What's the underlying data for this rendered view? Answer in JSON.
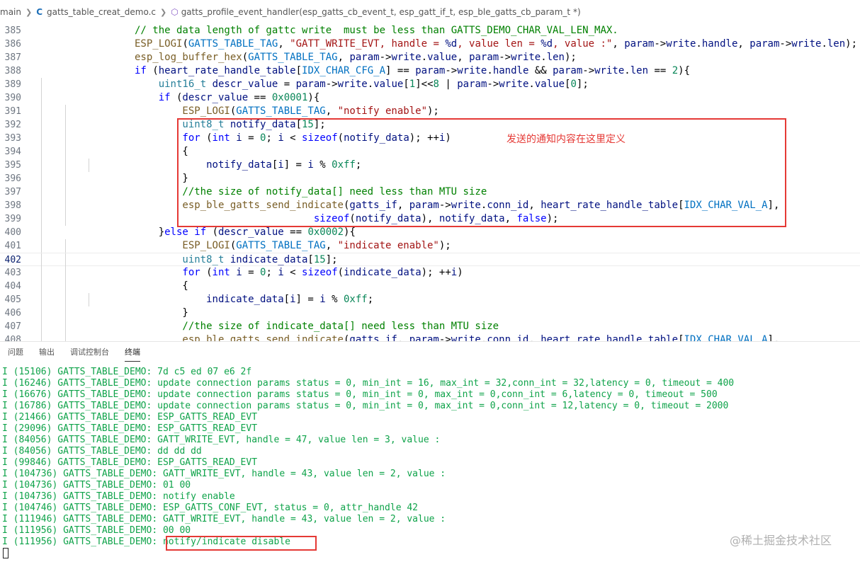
{
  "breadcrumb": {
    "items": [
      "main",
      "gatts_table_creat_demo.c",
      "gatts_profile_event_handler(esp_gatts_cb_event_t, esp_gatt_if_t, esp_ble_gatts_cb_param_t *)"
    ],
    "icons": [
      "c-file-icon",
      "function-cube-icon"
    ]
  },
  "editor": {
    "current_line": 402,
    "lines": [
      {
        "n": 385,
        "indent": 4,
        "tokens": [
          [
            "cm",
            "// the data length of gattc write  must be less than GATTS_DEMO_CHAR_VAL_LEN_MAX."
          ]
        ]
      },
      {
        "n": 386,
        "indent": 4,
        "tokens": [
          [
            "fn",
            "ESP_LOGI"
          ],
          [
            "plain",
            "("
          ],
          [
            "mac",
            "GATTS_TABLE_TAG"
          ],
          [
            "plain",
            ", "
          ],
          [
            "str",
            "\"GATT_WRITE_EVT, handle = "
          ],
          [
            "var",
            "%d"
          ],
          [
            "str",
            ", value len = "
          ],
          [
            "var",
            "%d"
          ],
          [
            "str",
            ", value :\""
          ],
          [
            "plain",
            ", "
          ],
          [
            "var",
            "param"
          ],
          [
            "plain",
            "->"
          ],
          [
            "var",
            "write"
          ],
          [
            "plain",
            "."
          ],
          [
            "var",
            "handle"
          ],
          [
            "plain",
            ", "
          ],
          [
            "var",
            "param"
          ],
          [
            "plain",
            "->"
          ],
          [
            "var",
            "write"
          ],
          [
            "plain",
            "."
          ],
          [
            "var",
            "len"
          ],
          [
            "plain",
            ");"
          ]
        ]
      },
      {
        "n": 387,
        "indent": 4,
        "tokens": [
          [
            "fn",
            "esp_log_buffer_hex"
          ],
          [
            "plain",
            "("
          ],
          [
            "mac",
            "GATTS_TABLE_TAG"
          ],
          [
            "plain",
            ", "
          ],
          [
            "var",
            "param"
          ],
          [
            "plain",
            "->"
          ],
          [
            "var",
            "write"
          ],
          [
            "plain",
            "."
          ],
          [
            "var",
            "value"
          ],
          [
            "plain",
            ", "
          ],
          [
            "var",
            "param"
          ],
          [
            "plain",
            "->"
          ],
          [
            "var",
            "write"
          ],
          [
            "plain",
            "."
          ],
          [
            "var",
            "len"
          ],
          [
            "plain",
            ");"
          ]
        ]
      },
      {
        "n": 388,
        "indent": 4,
        "tokens": [
          [
            "kw",
            "if"
          ],
          [
            "plain",
            " ("
          ],
          [
            "var",
            "heart_rate_handle_table"
          ],
          [
            "plain",
            "["
          ],
          [
            "mac",
            "IDX_CHAR_CFG_A"
          ],
          [
            "plain",
            "] == "
          ],
          [
            "var",
            "param"
          ],
          [
            "plain",
            "->"
          ],
          [
            "var",
            "write"
          ],
          [
            "plain",
            "."
          ],
          [
            "var",
            "handle"
          ],
          [
            "plain",
            " && "
          ],
          [
            "var",
            "param"
          ],
          [
            "plain",
            "->"
          ],
          [
            "var",
            "write"
          ],
          [
            "plain",
            "."
          ],
          [
            "var",
            "len"
          ],
          [
            "plain",
            " == "
          ],
          [
            "num",
            "2"
          ],
          [
            "plain",
            "){"
          ]
        ]
      },
      {
        "n": 389,
        "indent": 5,
        "tokens": [
          [
            "ty",
            "uint16_t"
          ],
          [
            "plain",
            " "
          ],
          [
            "var",
            "descr_value"
          ],
          [
            "plain",
            " = "
          ],
          [
            "var",
            "param"
          ],
          [
            "plain",
            "->"
          ],
          [
            "var",
            "write"
          ],
          [
            "plain",
            "."
          ],
          [
            "var",
            "value"
          ],
          [
            "plain",
            "["
          ],
          [
            "num",
            "1"
          ],
          [
            "plain",
            "]<<"
          ],
          [
            "num",
            "8"
          ],
          [
            "plain",
            " | "
          ],
          [
            "var",
            "param"
          ],
          [
            "plain",
            "->"
          ],
          [
            "var",
            "write"
          ],
          [
            "plain",
            "."
          ],
          [
            "var",
            "value"
          ],
          [
            "plain",
            "["
          ],
          [
            "num",
            "0"
          ],
          [
            "plain",
            "];"
          ]
        ]
      },
      {
        "n": 390,
        "indent": 5,
        "tokens": [
          [
            "kw",
            "if"
          ],
          [
            "plain",
            " ("
          ],
          [
            "var",
            "descr_value"
          ],
          [
            "plain",
            " == "
          ],
          [
            "num",
            "0x0001"
          ],
          [
            "plain",
            "){"
          ]
        ]
      },
      {
        "n": 391,
        "indent": 6,
        "tokens": [
          [
            "fn",
            "ESP_LOGI"
          ],
          [
            "plain",
            "("
          ],
          [
            "mac",
            "GATTS_TABLE_TAG"
          ],
          [
            "plain",
            ", "
          ],
          [
            "str",
            "\"notify enable\""
          ],
          [
            "plain",
            ");"
          ]
        ]
      },
      {
        "n": 392,
        "indent": 6,
        "tokens": [
          [
            "ty",
            "uint8_t"
          ],
          [
            "plain",
            " "
          ],
          [
            "var",
            "notify_data"
          ],
          [
            "plain",
            "["
          ],
          [
            "num",
            "15"
          ],
          [
            "plain",
            "];"
          ]
        ]
      },
      {
        "n": 393,
        "indent": 6,
        "tokens": [
          [
            "kw",
            "for"
          ],
          [
            "plain",
            " ("
          ],
          [
            "kw",
            "int"
          ],
          [
            "plain",
            " "
          ],
          [
            "var",
            "i"
          ],
          [
            "plain",
            " = "
          ],
          [
            "num",
            "0"
          ],
          [
            "plain",
            "; "
          ],
          [
            "var",
            "i"
          ],
          [
            "plain",
            " < "
          ],
          [
            "kw",
            "sizeof"
          ],
          [
            "plain",
            "("
          ],
          [
            "var",
            "notify_data"
          ],
          [
            "plain",
            "); ++"
          ],
          [
            "var",
            "i"
          ],
          [
            "plain",
            ")"
          ]
        ]
      },
      {
        "n": 394,
        "indent": 6,
        "tokens": [
          [
            "plain",
            "{"
          ]
        ]
      },
      {
        "n": 395,
        "indent": 7,
        "tokens": [
          [
            "var",
            "notify_data"
          ],
          [
            "plain",
            "["
          ],
          [
            "var",
            "i"
          ],
          [
            "plain",
            "] = "
          ],
          [
            "var",
            "i"
          ],
          [
            "plain",
            " % "
          ],
          [
            "num",
            "0xff"
          ],
          [
            "plain",
            ";"
          ]
        ]
      },
      {
        "n": 396,
        "indent": 6,
        "tokens": [
          [
            "plain",
            "}"
          ]
        ]
      },
      {
        "n": 397,
        "indent": 6,
        "tokens": [
          [
            "cm",
            "//the size of notify_data[] need less than MTU size"
          ]
        ]
      },
      {
        "n": 398,
        "indent": 6,
        "tokens": [
          [
            "fn",
            "esp_ble_gatts_send_indicate"
          ],
          [
            "plain",
            "("
          ],
          [
            "var",
            "gatts_if"
          ],
          [
            "plain",
            ", "
          ],
          [
            "var",
            "param"
          ],
          [
            "plain",
            "->"
          ],
          [
            "var",
            "write"
          ],
          [
            "plain",
            "."
          ],
          [
            "var",
            "conn_id"
          ],
          [
            "plain",
            ", "
          ],
          [
            "var",
            "heart_rate_handle_table"
          ],
          [
            "plain",
            "["
          ],
          [
            "mac",
            "IDX_CHAR_VAL_A"
          ],
          [
            "plain",
            "],"
          ]
        ]
      },
      {
        "n": 399,
        "indent": 6,
        "pad": "                      ",
        "tokens": [
          [
            "kw",
            "sizeof"
          ],
          [
            "plain",
            "("
          ],
          [
            "var",
            "notify_data"
          ],
          [
            "plain",
            "), "
          ],
          [
            "var",
            "notify_data"
          ],
          [
            "plain",
            ", "
          ],
          [
            "kw",
            "false"
          ],
          [
            "plain",
            ");"
          ]
        ]
      },
      {
        "n": 400,
        "indent": 5,
        "tokens": [
          [
            "plain",
            "}"
          ],
          [
            "kw",
            "else if"
          ],
          [
            "plain",
            " ("
          ],
          [
            "var",
            "descr_value"
          ],
          [
            "plain",
            " == "
          ],
          [
            "num",
            "0x0002"
          ],
          [
            "plain",
            "){"
          ]
        ]
      },
      {
        "n": 401,
        "indent": 6,
        "tokens": [
          [
            "fn",
            "ESP_LOGI"
          ],
          [
            "plain",
            "("
          ],
          [
            "mac",
            "GATTS_TABLE_TAG"
          ],
          [
            "plain",
            ", "
          ],
          [
            "str",
            "\"indicate enable\""
          ],
          [
            "plain",
            ");"
          ]
        ]
      },
      {
        "n": 402,
        "indent": 6,
        "tokens": [
          [
            "ty",
            "uint8_t"
          ],
          [
            "plain",
            " "
          ],
          [
            "var",
            "indicate_data"
          ],
          [
            "plain",
            "["
          ],
          [
            "num",
            "15"
          ],
          [
            "plain",
            "];"
          ]
        ]
      },
      {
        "n": 403,
        "indent": 6,
        "tokens": [
          [
            "kw",
            "for"
          ],
          [
            "plain",
            " ("
          ],
          [
            "kw",
            "int"
          ],
          [
            "plain",
            " "
          ],
          [
            "var",
            "i"
          ],
          [
            "plain",
            " = "
          ],
          [
            "num",
            "0"
          ],
          [
            "plain",
            "; "
          ],
          [
            "var",
            "i"
          ],
          [
            "plain",
            " < "
          ],
          [
            "kw",
            "sizeof"
          ],
          [
            "plain",
            "("
          ],
          [
            "var",
            "indicate_data"
          ],
          [
            "plain",
            "); ++"
          ],
          [
            "var",
            "i"
          ],
          [
            "plain",
            ")"
          ]
        ]
      },
      {
        "n": 404,
        "indent": 6,
        "tokens": [
          [
            "plain",
            "{"
          ]
        ]
      },
      {
        "n": 405,
        "indent": 7,
        "tokens": [
          [
            "var",
            "indicate_data"
          ],
          [
            "plain",
            "["
          ],
          [
            "var",
            "i"
          ],
          [
            "plain",
            "] = "
          ],
          [
            "var",
            "i"
          ],
          [
            "plain",
            " % "
          ],
          [
            "num",
            "0xff"
          ],
          [
            "plain",
            ";"
          ]
        ]
      },
      {
        "n": 406,
        "indent": 6,
        "tokens": [
          [
            "plain",
            "}"
          ]
        ]
      },
      {
        "n": 407,
        "indent": 6,
        "tokens": [
          [
            "cm",
            "//the size of indicate_data[] need less than MTU size"
          ]
        ]
      },
      {
        "n": 408,
        "indent": 6,
        "tokens": [
          [
            "fn",
            "esp_ble_gatts_send_indicate"
          ],
          [
            "plain",
            "("
          ],
          [
            "var",
            "gatts_if"
          ],
          [
            "plain",
            ", "
          ],
          [
            "var",
            "param"
          ],
          [
            "plain",
            "->"
          ],
          [
            "var",
            "write"
          ],
          [
            "plain",
            "."
          ],
          [
            "var",
            "conn_id"
          ],
          [
            "plain",
            ", "
          ],
          [
            "var",
            "heart_rate_handle_table"
          ],
          [
            "plain",
            "["
          ],
          [
            "mac",
            "IDX_CHAR_VAL_A"
          ],
          [
            "plain",
            "],"
          ]
        ]
      }
    ],
    "annotation": "发送的通知内容在这里定义"
  },
  "panel": {
    "tabs": [
      "问题",
      "输出",
      "调试控制台",
      "终端"
    ],
    "active_tab": 3
  },
  "terminal": {
    "lines": [
      "I (15106) GATTS_TABLE_DEMO: 7d c5 ed 07 e6 2f",
      "I (16246) GATTS_TABLE_DEMO: update connection params status = 0, min_int = 16, max_int = 32,conn_int = 32,latency = 0, timeout = 400",
      "I (16676) GATTS_TABLE_DEMO: update connection params status = 0, min_int = 0, max_int = 0,conn_int = 6,latency = 0, timeout = 500",
      "I (16786) GATTS_TABLE_DEMO: update connection params status = 0, min_int = 0, max_int = 0,conn_int = 12,latency = 0, timeout = 2000",
      "I (21466) GATTS_TABLE_DEMO: ESP_GATTS_READ_EVT",
      "I (29096) GATTS_TABLE_DEMO: ESP_GATTS_READ_EVT",
      "I (84056) GATTS_TABLE_DEMO: GATT_WRITE_EVT, handle = 47, value len = 3, value :",
      "I (84056) GATTS_TABLE_DEMO: dd dd dd",
      "I (99846) GATTS_TABLE_DEMO: ESP_GATTS_READ_EVT",
      "I (104736) GATTS_TABLE_DEMO: GATT_WRITE_EVT, handle = 43, value len = 2, value :",
      "I (104736) GATTS_TABLE_DEMO: 01 00",
      "I (104736) GATTS_TABLE_DEMO: notify enable",
      "I (104746) GATTS_TABLE_DEMO: ESP_GATTS_CONF_EVT, status = 0, attr_handle 42",
      "I (111946) GATTS_TABLE_DEMO: GATT_WRITE_EVT, handle = 43, value len = 2, value :",
      "I (111956) GATTS_TABLE_DEMO: 00 00",
      "I (111956) GATTS_TABLE_DEMO: notify/indicate disable"
    ]
  },
  "watermark": "@稀土掘金技术社区",
  "colors": {
    "annotation_red": "#e53935",
    "terminal_green": "#0fa34a"
  }
}
